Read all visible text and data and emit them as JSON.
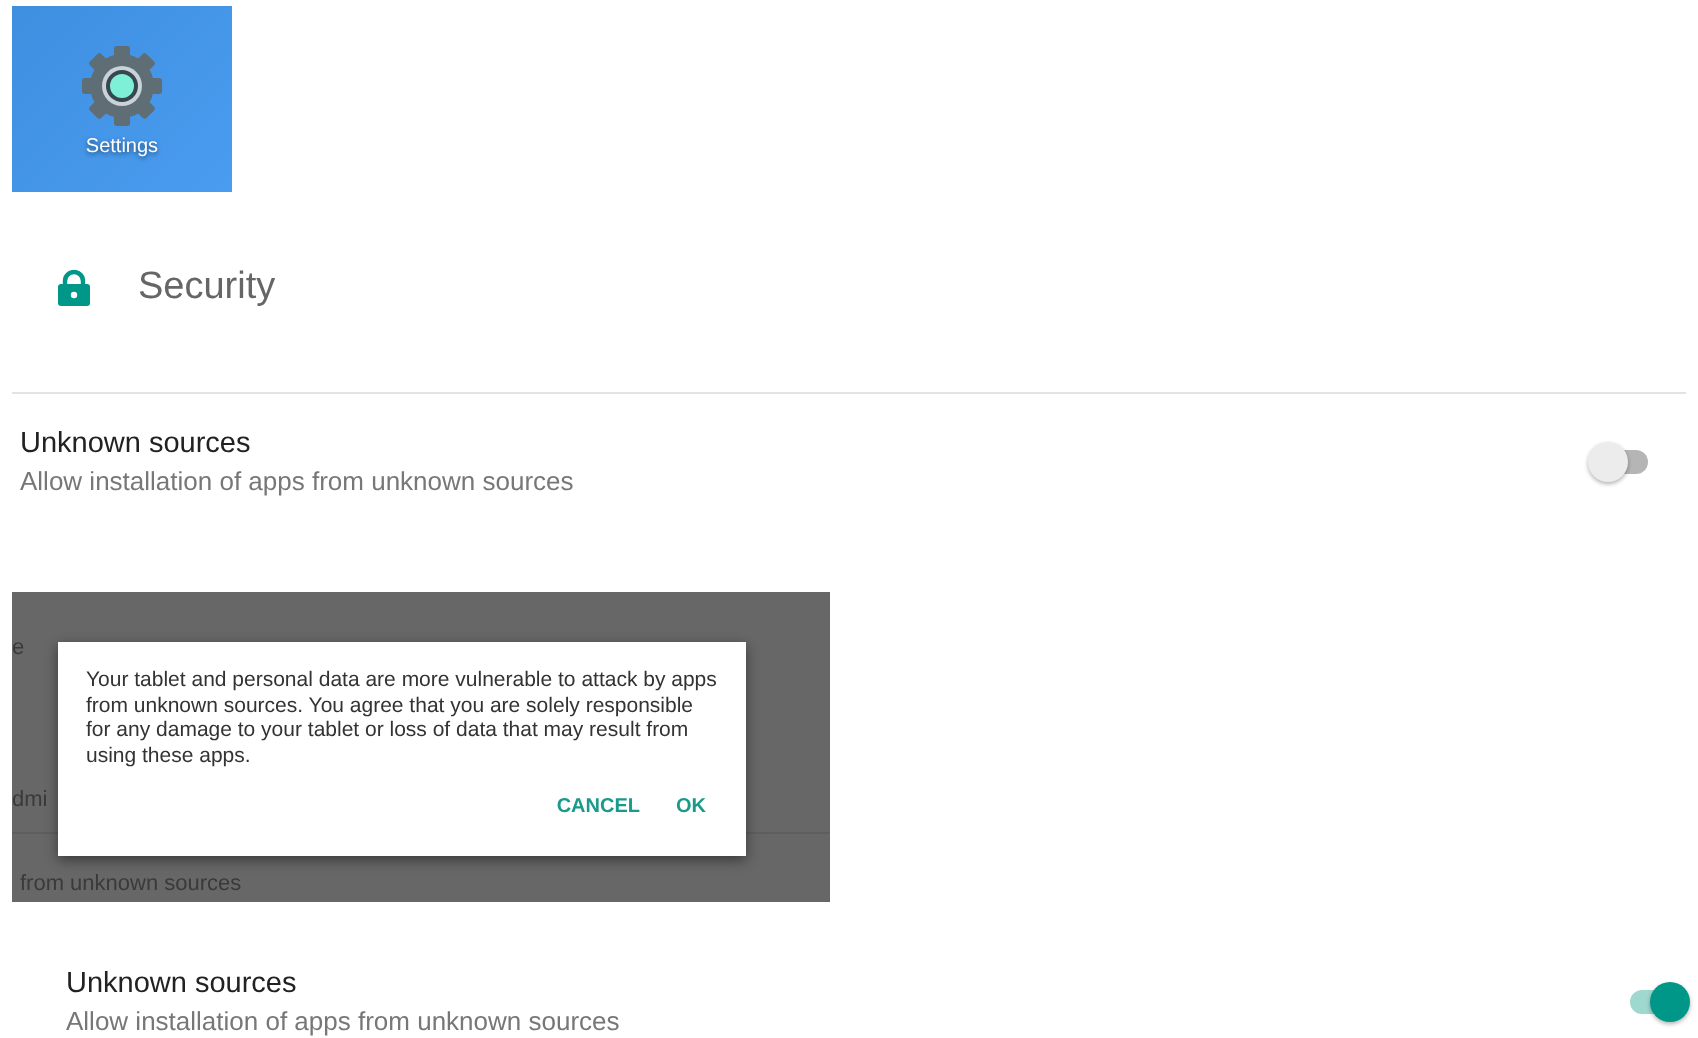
{
  "app_icon": {
    "label": "Settings"
  },
  "header": {
    "title": "Security"
  },
  "settings": [
    {
      "title": "Unknown sources",
      "subtitle": "Allow installation of apps from unknown sources",
      "on": false
    }
  ],
  "dialog_screenshot": {
    "background_fragments": [
      "e",
      "dmi",
      "from unknown sources"
    ],
    "message": "Your tablet and personal data are more vulnerable to attack by apps from unknown sources. You agree that you are solely responsible for any damage to your tablet or loss of data that may result from using these apps.",
    "buttons": [
      "CANCEL",
      "OK"
    ]
  },
  "settings_after": [
    {
      "title": "Unknown sources",
      "subtitle": "Allow installation of apps from unknown sources",
      "on": true
    }
  ]
}
